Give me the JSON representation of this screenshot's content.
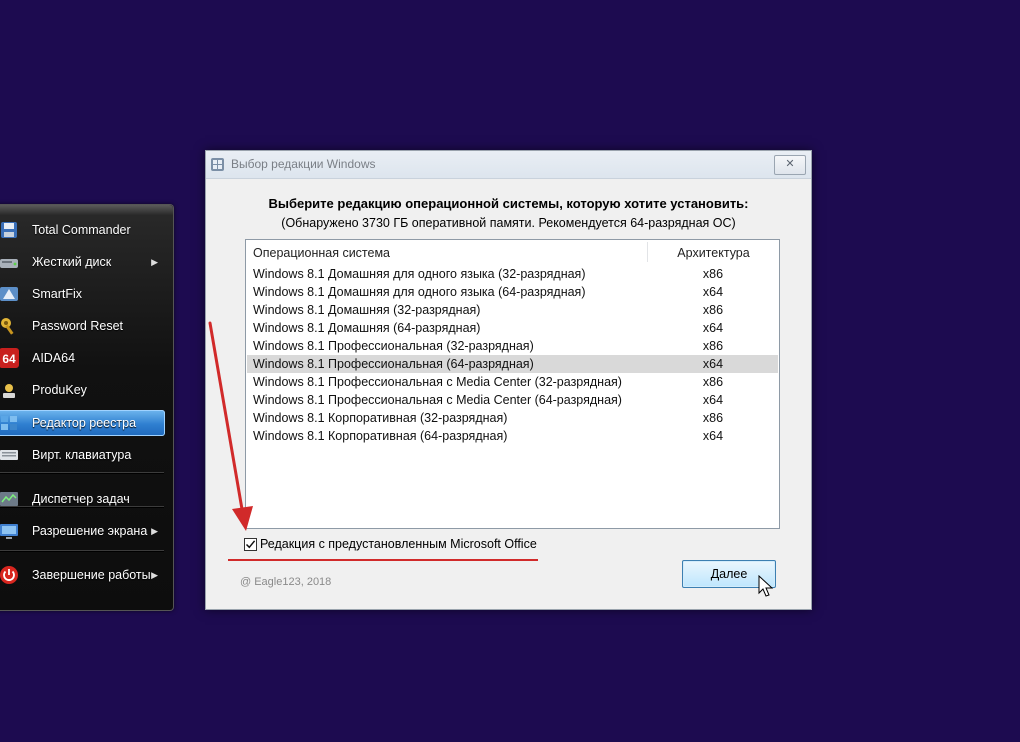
{
  "launcher": {
    "items": [
      {
        "label": "Total Commander",
        "icon": "floppy-disk-icon",
        "submenu": false
      },
      {
        "label": "Жесткий диск",
        "icon": "hard-drive-icon",
        "submenu": true
      },
      {
        "label": "SmartFix",
        "icon": "smartfix-icon",
        "submenu": false
      },
      {
        "label": "Password Reset",
        "icon": "keys-icon",
        "submenu": false
      },
      {
        "label": "AIDA64",
        "icon": "aida64-icon",
        "icon_text": "64",
        "submenu": false
      },
      {
        "label": "ProduKey",
        "icon": "produkey-icon",
        "submenu": false
      },
      {
        "label": "Редактор реестра",
        "icon": "registry-editor-icon",
        "submenu": false,
        "selected": true
      },
      {
        "label": "Вирт. клавиатура",
        "icon": "keyboard-icon",
        "submenu": false
      },
      {
        "label": "Диспетчер задач",
        "icon": "task-manager-icon",
        "submenu": false
      },
      {
        "label": "Разрешение экрана",
        "icon": "monitor-icon",
        "submenu": true
      },
      {
        "label": "Завершение работы",
        "icon": "power-icon",
        "submenu": true
      }
    ]
  },
  "dialog": {
    "title": "Выбор редакции Windows",
    "close_glyph": "✕",
    "heading": "Выберите редакцию операционной системы, которую хотите установить:",
    "subheading": "(Обнаружено 3730 ГБ оперативной памяти. Рекомендуется 64-разрядная ОС)",
    "columns": {
      "os": "Операционная система",
      "arch": "Архитектура"
    },
    "rows": [
      {
        "os": "Windows 8.1 Домашняя для одного языка (32-разрядная)",
        "arch": "x86"
      },
      {
        "os": "Windows 8.1 Домашняя для одного языка (64-разрядная)",
        "arch": "x64"
      },
      {
        "os": "Windows 8.1 Домашняя (32-разрядная)",
        "arch": "x86"
      },
      {
        "os": "Windows 8.1 Домашняя (64-разрядная)",
        "arch": "x64"
      },
      {
        "os": "Windows 8.1 Профессиональная (32-разрядная)",
        "arch": "x86"
      },
      {
        "os": "Windows 8.1 Профессиональная (64-разрядная)",
        "arch": "x64",
        "highlighted": true
      },
      {
        "os": "Windows 8.1 Профессиональная с Media Center (32-разрядная)",
        "arch": "x86"
      },
      {
        "os": "Windows 8.1 Профессиональная с Media Center (64-разрядная)",
        "arch": "x64"
      },
      {
        "os": "Windows 8.1 Корпоративная (32-разрядная)",
        "arch": "x86"
      },
      {
        "os": "Windows 8.1 Корпоративная (64-разрядная)",
        "arch": "x64"
      }
    ],
    "office_checkbox": {
      "label": "Редакция с предустановленным Microsoft Office",
      "checked": true
    },
    "copyright": "@ Eagle123, 2018",
    "next_button": "Далее"
  },
  "colors": {
    "desktop": "#1d0b50",
    "annotation_red": "#d12a2a",
    "selected_menu_blue": "#2f7fd0"
  }
}
